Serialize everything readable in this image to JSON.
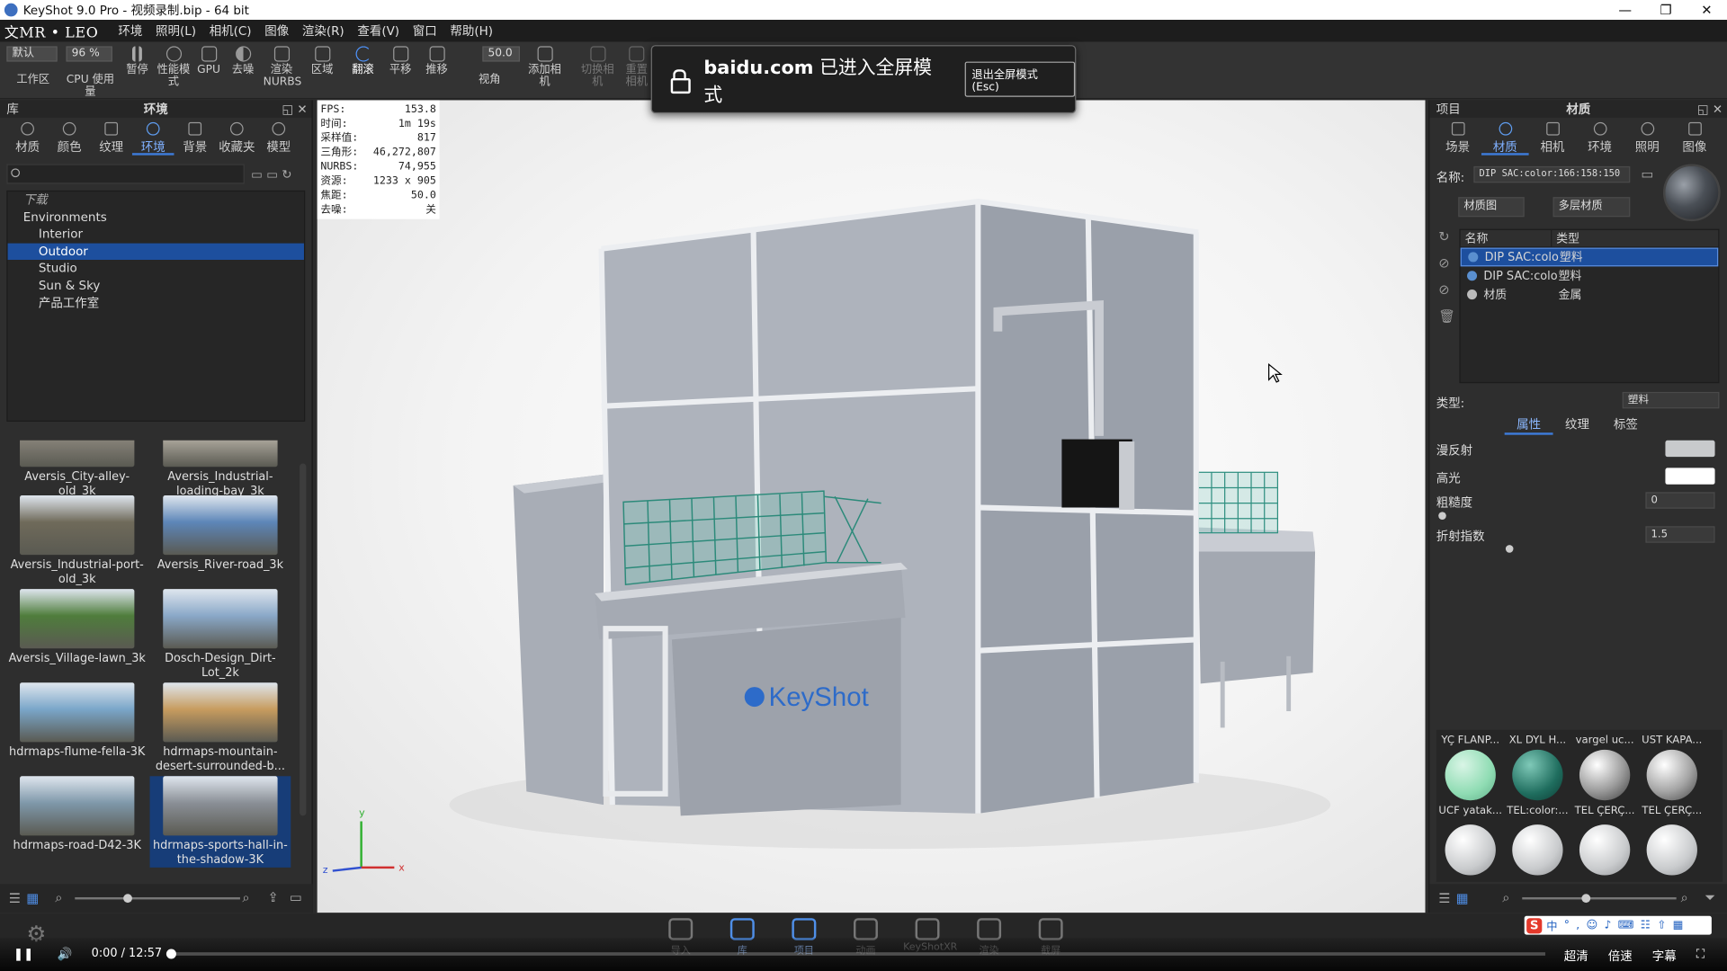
{
  "window": {
    "title": "KeyShot 9.0 Pro - 视频录制.bip - 64 bit",
    "controls": [
      "—",
      "❐",
      "✕"
    ]
  },
  "menubar": {
    "brand": "文MR • LEO",
    "items": [
      "环境",
      "照明(L)",
      "相机(C)",
      "图像",
      "渲染(R)",
      "查看(V)",
      "窗口",
      "帮助(H)"
    ]
  },
  "toolbar": {
    "preset_value": "默认",
    "zoom_value": "96 %",
    "focal_value": "50.0",
    "items": [
      "工作区",
      "CPU 使用量",
      "暂停",
      "性能模式",
      "GPU",
      "去噪",
      "渲染NURBS",
      "区域",
      "翻滚",
      "平移",
      "推移",
      "视角",
      "添加相机",
      "切换相机",
      "重置相机"
    ]
  },
  "fullscreen_banner": {
    "domain": "baidu.com",
    "message": "已进入全屏模式",
    "exit_label": "退出全屏模式 (Esc)"
  },
  "left_panel": {
    "header": "库",
    "title": "环境",
    "tabs": [
      "材质",
      "颜色",
      "纹理",
      "环境",
      "背景",
      "收藏夹",
      "模型"
    ],
    "active_tab": "环境",
    "search_placeholder": "",
    "tree": [
      {
        "label": "下载",
        "level": 1
      },
      {
        "label": "Environments",
        "level": 1
      },
      {
        "label": "Interior",
        "level": 2
      },
      {
        "label": "Outdoor",
        "level": 2,
        "selected": true
      },
      {
        "label": "Studio",
        "level": 2
      },
      {
        "label": "Sun & Sky",
        "level": 2
      },
      {
        "label": "产品工作室",
        "level": 2
      }
    ],
    "thumbnails": [
      {
        "label": "Aversis_City-alley-old_3k",
        "color": "#8f8a80"
      },
      {
        "label": "Aversis_Industrial-loading-bay_3k",
        "color": "#b9b3a8"
      },
      {
        "label": "Aversis_Industrial-port-old_3k",
        "color": "#6f6a5a"
      },
      {
        "label": "Aversis_River-road_3k",
        "color": "#5d86b8"
      },
      {
        "label": "Aversis_Village-lawn_3k",
        "color": "#4f7d3c"
      },
      {
        "label": "Dosch-Design_Dirt-Lot_2k",
        "color": "#8aa8c8"
      },
      {
        "label": "hdrmaps-flume-fella-3K",
        "color": "#7aa6c9"
      },
      {
        "label": "hdrmaps-mountain-desert-surrounded-b...",
        "color": "#c79c5f"
      },
      {
        "label": "hdrmaps-road-D42-3K",
        "color": "#7f98aa"
      },
      {
        "label": "hdrmaps-sports-hall-in-the-shadow-3K",
        "color": "#8a8f96",
        "selected": true
      }
    ]
  },
  "stats": [
    {
      "k": "FPS:",
      "v": "153.8"
    },
    {
      "k": "时间:",
      "v": "1m 19s"
    },
    {
      "k": "采样值:",
      "v": "817"
    },
    {
      "k": "三角形:",
      "v": "46,272,807"
    },
    {
      "k": "NURBS:",
      "v": "74,955"
    },
    {
      "k": "资源:",
      "v": "1233 x 905"
    },
    {
      "k": "焦距:",
      "v": "50.0"
    },
    {
      "k": "去噪:",
      "v": "关"
    }
  ],
  "viewport": {
    "logo_text": "KeyShot",
    "axis_labels": [
      "y",
      "x",
      "z"
    ]
  },
  "right_panel": {
    "header": "项目",
    "title": "材质",
    "tabs": [
      "场景",
      "材质",
      "相机",
      "环境",
      "照明",
      "图像"
    ],
    "active_tab": "材质",
    "name_label": "名称:",
    "name_value": "DIP SAC:color:166:158:150",
    "btn_material_graph": "材质图",
    "btn_multilayer": "多层材质",
    "table_headers": [
      "名称",
      "类型"
    ],
    "materials": [
      {
        "name": "DIP SAC:colo",
        "type": "塑料",
        "selected": true
      },
      {
        "name": "DIP SAC:colo",
        "type": "塑料"
      },
      {
        "name": "材质",
        "type": "金属"
      }
    ],
    "type_label": "类型:",
    "type_value": "塑料",
    "sub_tabs": [
      "属性",
      "纹理",
      "标签"
    ],
    "properties": [
      {
        "label": "漫反射",
        "value": ""
      },
      {
        "label": "高光",
        "value": ""
      },
      {
        "label": "粗糙度",
        "value": "0"
      },
      {
        "label": "折射指数",
        "value": "1.5"
      }
    ],
    "palette_top": [
      "YÇ FLANP...",
      "XL DYL H...",
      "vargel uc...",
      "UST KAPA..."
    ],
    "palette_mid": [
      "UCF yatak...",
      "TEL:color:...",
      "TEL ÇERÇ...",
      "TEL ÇERÇ..."
    ],
    "colors": {
      "accent": "#3d7bd9",
      "selection": "#1d4f9e"
    }
  },
  "bottom_tabs": [
    "导入",
    "库",
    "项目",
    "动画",
    "KeyShotXR",
    "渲染",
    "截屏"
  ],
  "bottom_active": "项目",
  "player": {
    "time": "0:00 / 12:57",
    "progress": 0.0,
    "right_controls": [
      "超清",
      "倍速",
      "字幕"
    ]
  },
  "ime": {
    "label": "中"
  }
}
